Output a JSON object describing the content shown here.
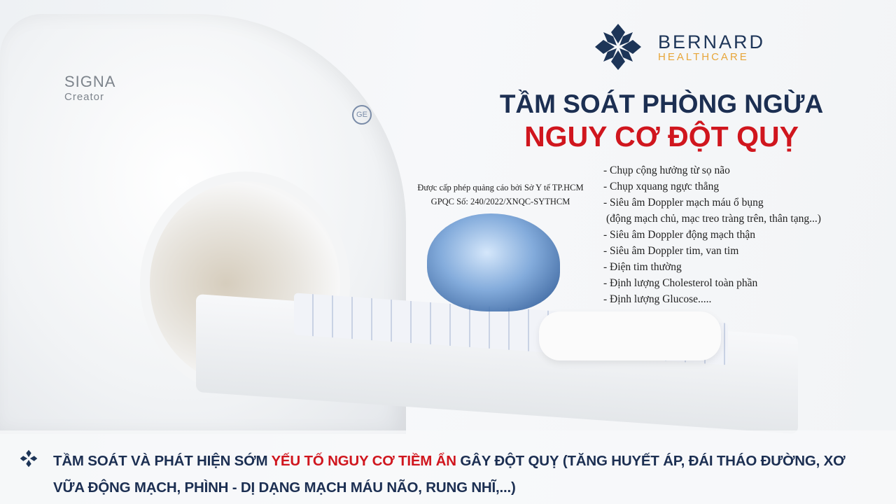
{
  "brand": {
    "name": "BERNARD",
    "sub": "HEALTHCARE",
    "navy": "#1d3558",
    "gold": "#e7a63a"
  },
  "machine": {
    "model": "SIGNA",
    "model_sub": "Creator",
    "maker_badge": "GE"
  },
  "title": {
    "line1": "TẦM SOÁT PHÒNG NGỪA",
    "line2": "NGUY CƠ ĐỘT QUỴ",
    "red": "#d0161e"
  },
  "license": {
    "line1": "Được cấp phép quảng cáo bởi Sở Y tế TP.HCM",
    "line2": "GPQC Số: 240/2022/XNQC-SYTHCM"
  },
  "services": [
    "- Chụp cộng hưởng từ sọ não",
    "- Chụp xquang ngực thẳng",
    "- Siêu âm Doppler mạch máu ổ bụng",
    " (động mạch chủ, mạc treo tràng trên, thân tạng...)",
    "- Siêu âm Doppler động mạch thận",
    "- Siêu âm Doppler tim, van tim",
    "- Điện tim thường",
    "- Định lượng Cholesterol toàn phần",
    "- Định lượng Glucose....."
  ],
  "bottom": {
    "part1": "TẦM SOÁT VÀ PHÁT HIỆN SỚM ",
    "highlight": "YẾU TỐ NGUY CƠ TIỀM ẨN",
    "part2": " GÂY ĐỘT QUỴ (TĂNG HUYẾT ÁP, ĐÁI THÁO ĐƯỜNG, XƠ VỮA ĐỘNG MẠCH, PHÌNH - DỊ DẠNG MẠCH MÁU NÃO, RUNG NHĨ,...)"
  }
}
